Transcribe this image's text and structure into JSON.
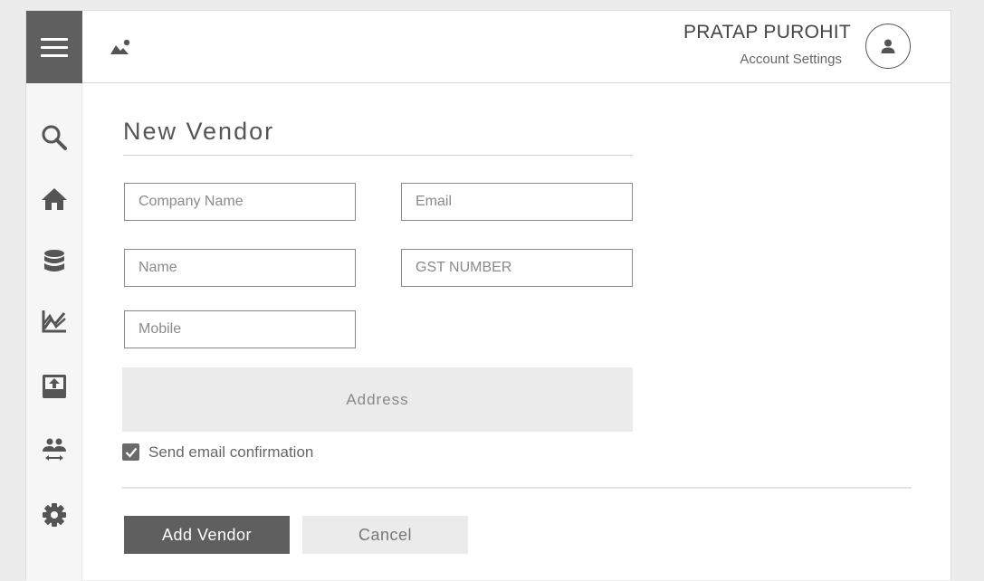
{
  "colors": {
    "sidebar_header_block": "#5f5f5f",
    "primary_button": "#5f5f5f",
    "secondary_button": "#ebebeb",
    "page_background": "#ececec"
  },
  "header": {
    "menu_icon": "hamburger-menu-icon",
    "logo_icon": "mountain-image-icon",
    "user_name": "PRATAP PUROHIT",
    "account_settings": "Account Settings",
    "avatar_icon": "user-avatar-icon"
  },
  "sidebar": {
    "items": [
      {
        "icon": "search-icon"
      },
      {
        "icon": "home-icon"
      },
      {
        "icon": "database-icon"
      },
      {
        "icon": "chart-icon"
      },
      {
        "icon": "upload-inbox-icon"
      },
      {
        "icon": "people-swap-icon"
      },
      {
        "icon": "gear-icon"
      }
    ]
  },
  "form": {
    "title": "New Vendor",
    "fields": {
      "company_name": {
        "placeholder": "Company Name",
        "value": ""
      },
      "email": {
        "placeholder": "Email",
        "value": ""
      },
      "name": {
        "placeholder": "Name",
        "value": ""
      },
      "gst_number": {
        "placeholder": "GST NUMBER",
        "value": ""
      },
      "mobile": {
        "placeholder": "Mobile",
        "value": ""
      }
    },
    "address_placeholder": "Address",
    "send_email_confirmation": {
      "label": "Send email confirmation",
      "checked": true
    },
    "add_button": "Add Vendor",
    "cancel_button": "Cancel"
  }
}
